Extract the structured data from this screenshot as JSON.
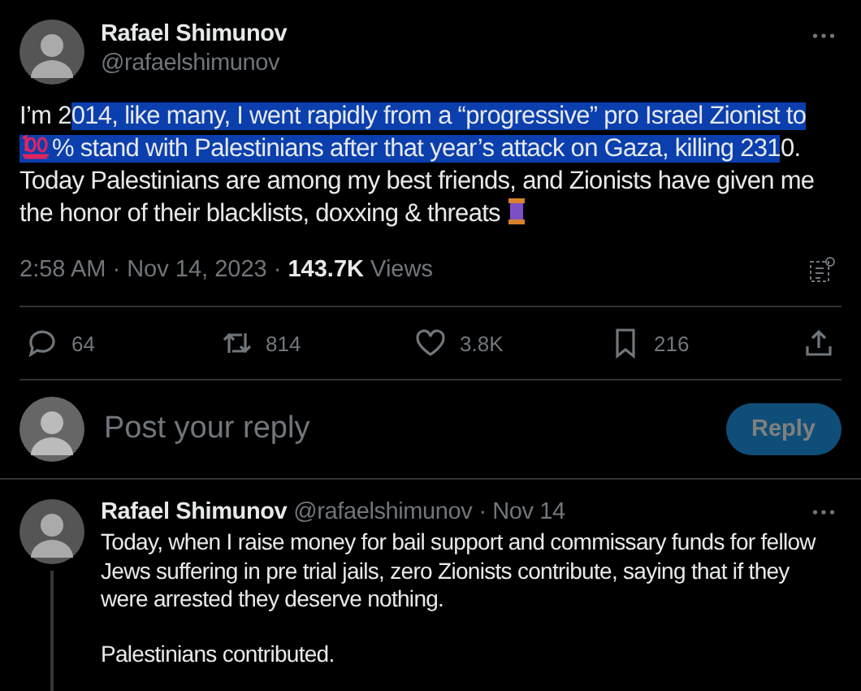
{
  "tweet": {
    "author": {
      "name": "Rafael Shimunov",
      "handle": "@rafaelshimunov"
    },
    "body": [
      {
        "kind": "text",
        "text": "I’m 2",
        "selected": false
      },
      {
        "kind": "text",
        "text": "014, like many, I went rapidly from a  “progressive” pro Israel Zionist to ",
        "selected": true
      },
      {
        "kind": "hundred",
        "selected": true
      },
      {
        "kind": "text",
        "text": "% stand with Palestinians after that year’s attack on Gaza, killing 231",
        "selected": true
      },
      {
        "kind": "text",
        "text": "0. Today Palestinians are among my best friends, and Zionists have given me the honor of their blacklists, doxxing & threats ",
        "selected": false
      },
      {
        "kind": "thread",
        "selected": false
      }
    ],
    "time": "2:58 AM · Nov 14, 2023 · ",
    "views_count": "143.7K",
    "views_label": " Views",
    "actions": [
      {
        "kind": "reply",
        "count": "64"
      },
      {
        "kind": "repost",
        "count": "814"
      },
      {
        "kind": "like",
        "count": "3.8K"
      },
      {
        "kind": "bookmark",
        "count": "216"
      },
      {
        "kind": "share"
      }
    ]
  },
  "composer": {
    "placeholder": "Post your reply",
    "button": "Reply"
  },
  "reply": {
    "author": {
      "name": "Rafael Shimunov",
      "handle": "@rafaelshimunov",
      "date": " · Nov 14"
    },
    "paragraphs": [
      "Today, when I raise money for bail support and commissary funds for fellow Jews suffering in pre trial jails, zero Zionists contribute, saying that if they were arrested they deserve nothing.",
      "Palestinians contributed."
    ]
  }
}
